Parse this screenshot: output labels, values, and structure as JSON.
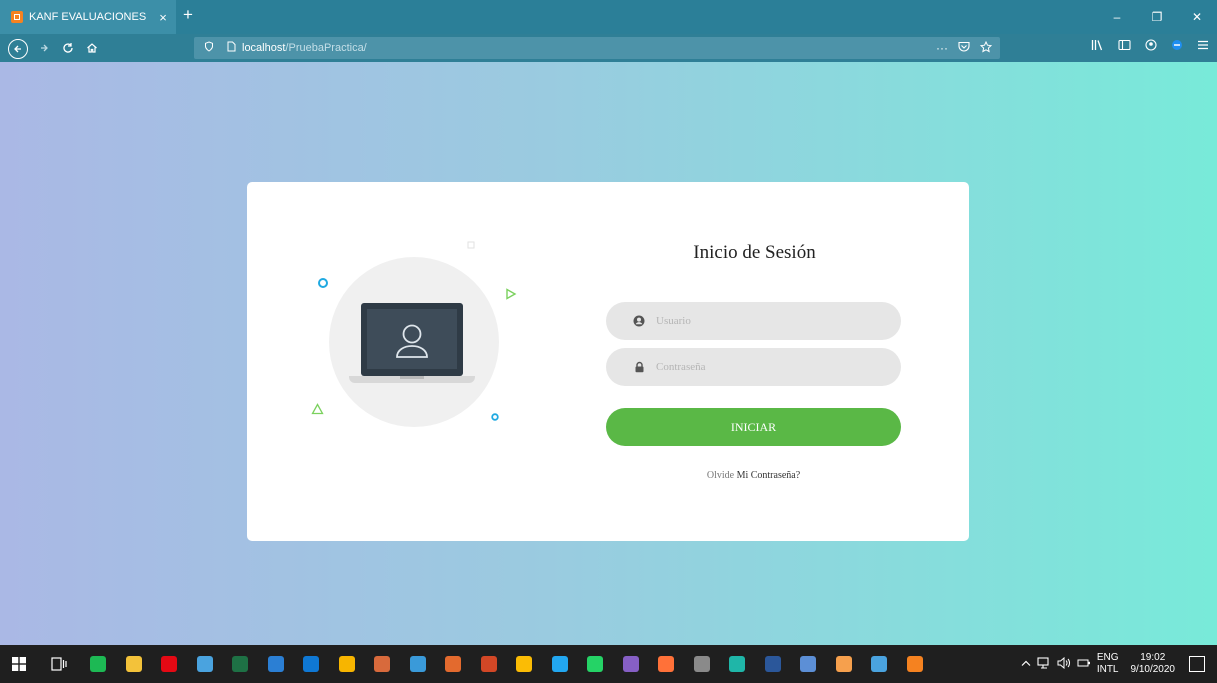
{
  "browser": {
    "tab_title": "KANF EVALUACIONES",
    "tab_close": "×",
    "new_tab": "+",
    "url_host": "localhost",
    "url_path": "/PruebaPractica/",
    "url_menu": "···",
    "window_controls": [
      "–",
      "❐",
      "✕"
    ]
  },
  "login": {
    "title": "Inicio de Sesión",
    "username_placeholder": "Usuario",
    "password_placeholder": "Contraseña",
    "submit_label": "INICIAR",
    "forgot_prefix": "Olvide",
    "forgot_link": "Mi Contraseña?"
  },
  "taskbar": {
    "lang_top": "ENG",
    "lang_bottom": "INTL",
    "time": "19:02",
    "date": "9/10/2020",
    "icons": [
      {
        "name": "spotify-icon",
        "color": "#1db954"
      },
      {
        "name": "file-explorer-icon",
        "color": "#f3c23a"
      },
      {
        "name": "netflix-icon",
        "color": "#e50914"
      },
      {
        "name": "notepad-icon",
        "color": "#4aa3df"
      },
      {
        "name": "excel-icon",
        "color": "#1e7145"
      },
      {
        "name": "app-icon",
        "color": "#2b7fd4"
      },
      {
        "name": "mail-icon",
        "color": "#0f78d4"
      },
      {
        "name": "app-icon",
        "color": "#f7b500"
      },
      {
        "name": "app-icon",
        "color": "#d86a3c"
      },
      {
        "name": "app-icon",
        "color": "#3a9ad9"
      },
      {
        "name": "app-icon",
        "color": "#e36a2e"
      },
      {
        "name": "powerpoint-icon",
        "color": "#d24726"
      },
      {
        "name": "chrome-icon",
        "color": "#fbbc05"
      },
      {
        "name": "vscode-icon",
        "color": "#22a7f0"
      },
      {
        "name": "whatsapp-icon",
        "color": "#25d366"
      },
      {
        "name": "visual-studio-icon",
        "color": "#865fc5"
      },
      {
        "name": "firefox-icon",
        "color": "#ff7139"
      },
      {
        "name": "app-icon",
        "color": "#8a8a8a"
      },
      {
        "name": "edge-icon",
        "color": "#1fb6a8"
      },
      {
        "name": "word-icon",
        "color": "#2b579a"
      },
      {
        "name": "virtualbox-icon",
        "color": "#5c8fd6"
      },
      {
        "name": "app-icon",
        "color": "#f6a04d"
      },
      {
        "name": "app-icon",
        "color": "#4aa3df"
      },
      {
        "name": "xampp-icon",
        "color": "#f58220"
      }
    ]
  },
  "colors": {
    "accent_green": "#5ab846",
    "deco_blue": "#1fa9e1",
    "deco_green": "#7bd15e"
  }
}
